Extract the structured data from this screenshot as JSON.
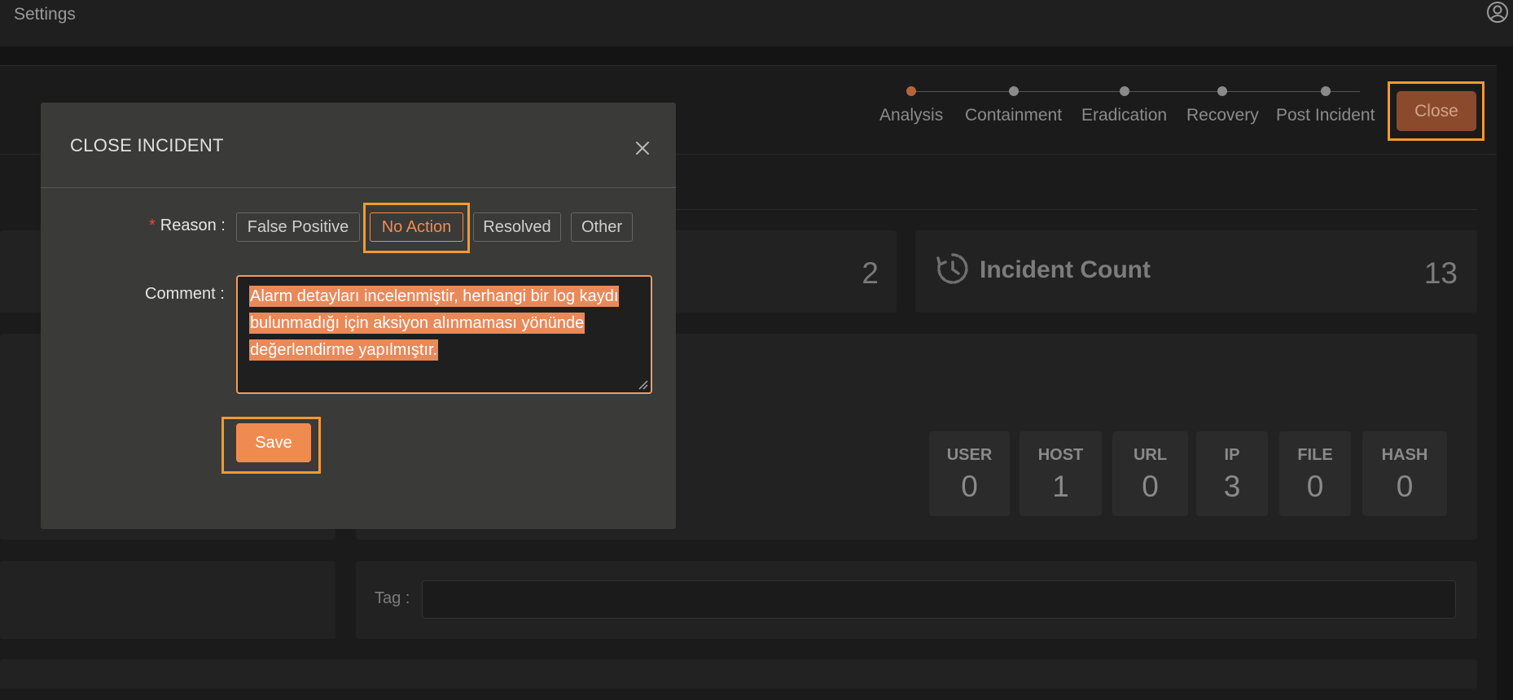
{
  "header": {
    "title": "Settings",
    "user_icon": "user-circle-icon"
  },
  "stepper": {
    "steps": [
      {
        "label": "Analysis",
        "active": true
      },
      {
        "label": "Containment",
        "active": false
      },
      {
        "label": "Eradication",
        "active": false
      },
      {
        "label": "Recovery",
        "active": false
      },
      {
        "label": "Post Incident",
        "active": false
      }
    ],
    "close_label": "Close"
  },
  "stats": {
    "left_count": "2",
    "incident_count_label": "Incident Count",
    "incident_count_value": "13"
  },
  "ioc": [
    {
      "label": "USER",
      "value": "0"
    },
    {
      "label": "HOST",
      "value": "1"
    },
    {
      "label": "URL",
      "value": "0"
    },
    {
      "label": "IP",
      "value": "3"
    },
    {
      "label": "FILE",
      "value": "0"
    },
    {
      "label": "HASH",
      "value": "0"
    }
  ],
  "tag": {
    "label": "Tag :",
    "value": ""
  },
  "modal": {
    "title": "CLOSE INCIDENT",
    "reason_required": "*",
    "reason_label": "Reason :",
    "reason_options": [
      "False Positive",
      "No Action",
      "Resolved",
      "Other"
    ],
    "selected_reason": "No Action",
    "comment_label": "Comment :",
    "comment_value": "Alarm detayları incelenmiştir, herhangi bir log kaydı bulunmadığı için aksiyon alınmaması yönünde değerlendirme yapılmıştır.",
    "save_label": "Save"
  },
  "colors": {
    "accent": "#f08b50",
    "highlight": "#f59a2c",
    "close_button": "#8b4a2c"
  }
}
